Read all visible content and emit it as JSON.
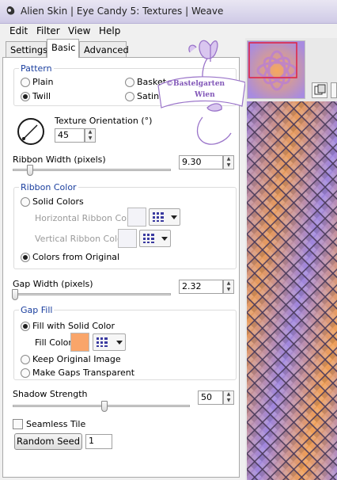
{
  "window": {
    "title": "Alien Skin | Eye Candy 5: Textures | Weave"
  },
  "menu": [
    "Edit",
    "Filter",
    "View",
    "Help"
  ],
  "tabs": [
    "Settings",
    "Basic",
    "Advanced"
  ],
  "pattern": {
    "title": "Pattern",
    "options": [
      "Plain",
      "Basket",
      "Twill",
      "Satin"
    ],
    "selected": "Twill"
  },
  "orientation": {
    "label": "Texture Orientation (°)",
    "value": "45"
  },
  "ribbon_width": {
    "label": "Ribbon Width (pixels)",
    "value": "9.30"
  },
  "ribbon_color": {
    "title": "Ribbon Color",
    "solid": "Solid Colors",
    "horizontal": "Horizontal Ribbon Color",
    "vertical": "Vertical Ribbon Color",
    "original": "Colors from Original"
  },
  "gap_width": {
    "label": "Gap Width (pixels)",
    "value": "2.32"
  },
  "gap_fill": {
    "title": "Gap Fill",
    "solid": "Fill with Solid Color",
    "fill_color_label": "Fill Color",
    "fill_color": "#f9a56a",
    "keep": "Keep Original Image",
    "transparent": "Make Gaps Transparent"
  },
  "shadow": {
    "label": "Shadow Strength",
    "value": "50"
  },
  "seamless": {
    "label": "Seamless Tile"
  },
  "random": {
    "button": "Random Seed",
    "value": "1"
  },
  "watermark": {
    "line1": "©Bastelgarten",
    "line2": "Wien"
  },
  "colors": {
    "accent": "#b58bd6",
    "weave_orange": "#f2a055",
    "weave_purple": "#9b7fe0"
  }
}
